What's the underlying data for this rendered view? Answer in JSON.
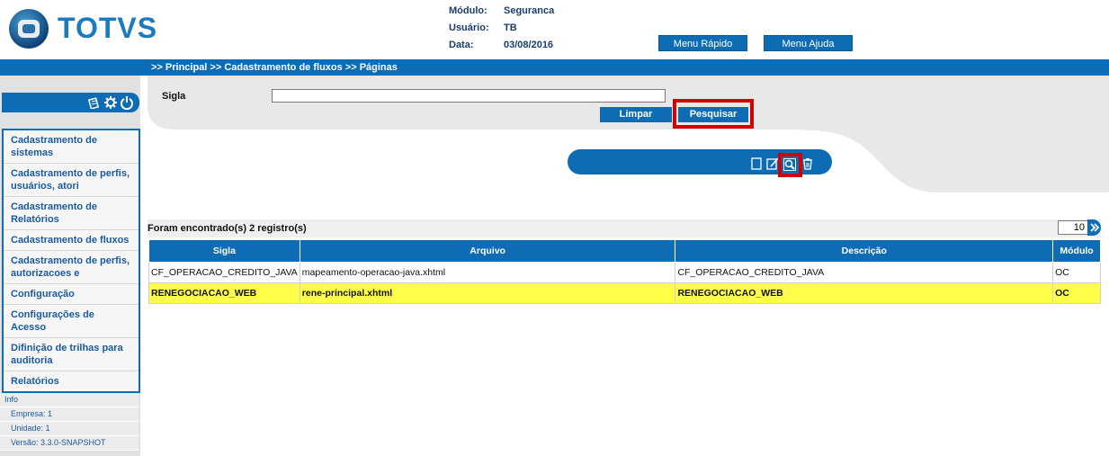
{
  "header": {
    "logo_text": "TOTVS",
    "modulo_label": "Módulo:",
    "modulo_value": "Seguranca",
    "usuario_label": "Usuário:",
    "usuario_value": "TB",
    "data_label": "Data:",
    "data_value": "03/08/2016",
    "menu_rapido": "Menu Rápido",
    "menu_ajuda": "Menu Ajuda"
  },
  "breadcrumb": ">> Principal >> Cadastramento de fluxos >> Páginas",
  "sidebar": {
    "items": [
      "Cadastramento de sistemas",
      "Cadastramento de perfis, usuários, atori",
      "Cadastramento de Relatórios",
      "Cadastramento de fluxos",
      "Cadastramento de perfis, autorizacoes e",
      "Configuração",
      "Configurações de Acesso",
      "Difinição de trilhas para auditoria",
      "Relatórios"
    ],
    "info_title": "Info",
    "empresa": "Empresa: 1",
    "unidade": "Unidade: 1",
    "versao": "Versão: 3.3.0-SNAPSHOT"
  },
  "filter": {
    "sigla_label": "Sigla",
    "sigla_value": "",
    "limpar": "Limpar",
    "pesquisar": "Pesquisar"
  },
  "toolbar": {
    "icons": [
      "new-icon",
      "edit-icon",
      "view-icon",
      "delete-icon"
    ]
  },
  "results": {
    "count_label": "Foram encontrado(s) 2 registro(s)",
    "page_size": "10",
    "columns": [
      "Sigla",
      "Arquivo",
      "Descrição",
      "Módulo"
    ],
    "rows": [
      {
        "sigla": "CF_OPERACAO_CREDITO_JAVA",
        "arquivo": "mapeamento-operacao-java.xhtml",
        "descricao": "CF_OPERACAO_CREDITO_JAVA",
        "modulo": "OC"
      },
      {
        "sigla": "RENEGOCIACAO_WEB",
        "arquivo": "rene-principal.xhtml",
        "descricao": "RENEGOCIACAO_WEB",
        "modulo": "OC"
      }
    ]
  },
  "colors": {
    "primary": "#0e6cb5",
    "highlight_row": "#ffff4a",
    "annotation_red": "#d40000"
  }
}
